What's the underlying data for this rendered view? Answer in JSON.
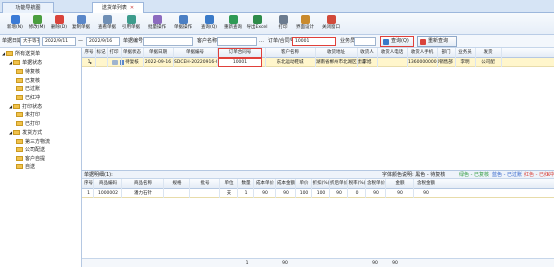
{
  "tabs": [
    {
      "label": "功能导航图"
    },
    {
      "label": "送货单列表"
    }
  ],
  "toolbar": [
    {
      "label": "新增(N)",
      "icon": "new-icon",
      "color": "#3b7bd6"
    },
    {
      "label": "修改(M)",
      "icon": "edit-icon",
      "color": "#4a9e3f"
    },
    {
      "label": "删除(D)",
      "icon": "delete-icon",
      "color": "#d9433b"
    },
    {
      "label": "复制单据",
      "icon": "copy-icon",
      "color": "#5a87c9"
    },
    {
      "label": "查看单据",
      "icon": "view-icon",
      "color": "#6f8fb5"
    },
    {
      "label": "引用单据",
      "icon": "refer-icon",
      "color": "#3d9c8c"
    },
    {
      "label": "批量操作",
      "icon": "batch-icon",
      "color": "#8c6bbf"
    },
    {
      "label": "单据操作",
      "icon": "doc-op-icon",
      "color": "#4b7fc4"
    },
    {
      "label": "查询(Q)",
      "icon": "query-icon",
      "color": "#3a7ac8"
    },
    {
      "label": "重新查询",
      "icon": "refresh-icon",
      "color": "#2f9a55"
    },
    {
      "label": "导出Excel",
      "icon": "excel-icon",
      "color": "#2e8b4a"
    },
    {
      "label": "打印",
      "icon": "print-icon",
      "color": "#6b7b8f"
    },
    {
      "label": "界面设计",
      "icon": "design-icon",
      "color": "#c98a2d"
    },
    {
      "label": "关闭窗口",
      "icon": "close-icon",
      "color": "#d24a3a"
    }
  ],
  "filter": {
    "date_label": "单据日期",
    "date_op": "大于等于",
    "date_from": "2022/9/11",
    "date_to": "2022/9/16",
    "doc_no_label": "单据编号",
    "customer_label": "客户名称",
    "order_label": "订单/合同号",
    "order_value": "10001",
    "salesman_label": "业务员",
    "query_button": "查询(Q)",
    "requery_button": "重新查询"
  },
  "tree": [
    {
      "label": "所有送货单",
      "level": 0,
      "expander": "◢"
    },
    {
      "label": "单据状态",
      "level": 1,
      "expander": "◢"
    },
    {
      "label": "待复核",
      "level": 2
    },
    {
      "label": "已复核",
      "level": 2
    },
    {
      "label": "已过账",
      "level": 2
    },
    {
      "label": "已红冲",
      "level": 2
    },
    {
      "label": "打印状态",
      "level": 1,
      "expander": "◢"
    },
    {
      "label": "未打印",
      "level": 2
    },
    {
      "label": "已打印",
      "level": 2
    },
    {
      "label": "发货方式",
      "level": 1,
      "expander": "◢"
    },
    {
      "label": "第三方物流",
      "level": 2
    },
    {
      "label": "公司配送",
      "level": 2
    },
    {
      "label": "客户自提",
      "level": 2
    },
    {
      "label": "自送",
      "level": 2
    }
  ],
  "grid": {
    "headers": [
      "序号",
      "标记",
      "打印",
      "单据状态",
      "单据日期",
      "单据编号",
      "订单合同号",
      "客户名称",
      "收货地址",
      "收货人",
      "收货人电话",
      "收货人手机",
      "部门",
      "业务员",
      "发货"
    ],
    "rows": [
      [
        "1",
        "",
        "",
        "待复核",
        "2022-09-16",
        "SDCEH-20220916-0013",
        "10001",
        "东北运动鞋城",
        "湖南省郴州市北湖区建设",
        "李旭",
        "",
        "13600000000",
        "销售部",
        "李明",
        "公司配"
      ]
    ]
  },
  "detail": {
    "title": "单据明细(1):",
    "legend_label": "字体颜色说明: 黑色 - 待复核",
    "legend_green": "绿色 - 已复核",
    "legend_blue": "蓝色 - 已过账",
    "legend_red": "红色 - 已红冲",
    "headers": [
      "序号",
      "商品编码",
      "商品名称",
      "规格",
      "批号",
      "单位",
      "数量",
      "成本单价",
      "成本金额",
      "单价",
      "折扣(%)",
      "折后单价",
      "税率(%)",
      "含税单价",
      "金额",
      "含税金额"
    ],
    "rows": [
      [
        "1",
        "1000002",
        "潘力石针",
        "",
        "",
        "支",
        "1",
        "90",
        "90",
        "100",
        "100",
        "90",
        "0",
        "90",
        "90",
        "90"
      ]
    ],
    "sum": [
      "1",
      "90",
      "",
      "",
      "",
      "90",
      "90"
    ]
  }
}
